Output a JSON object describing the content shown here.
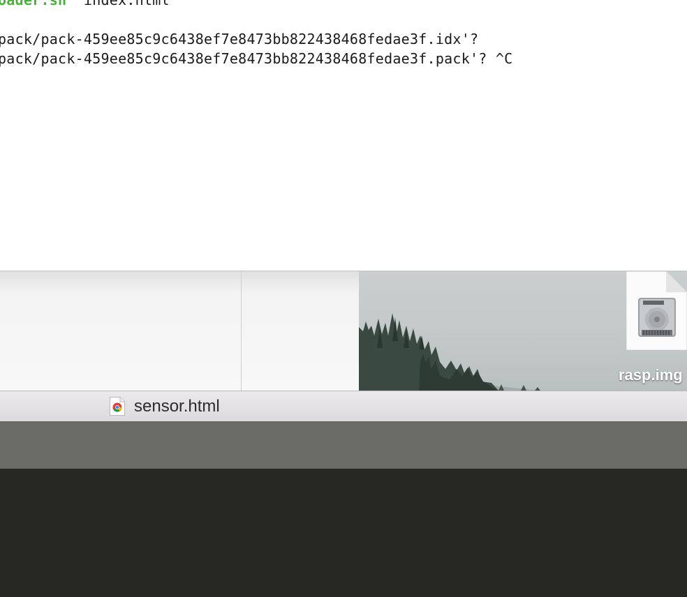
{
  "terminal": {
    "line0_green": "oader.sh",
    "line0_rest": "  index.html",
    "line1": "pack/pack-459ee85c9c6438ef7e8473bb822438468fedae3f.idx'?",
    "line2": "pack/pack-459ee85c9c6438ef7e8473bb822438468fedae3f.pack'? ^C"
  },
  "desktop": {
    "disk_label": "rasp.img"
  },
  "tab": {
    "file_name": "sensor.html"
  },
  "colors": {
    "terminal_bg": "#ffffff",
    "terminal_text": "#1a1a1a",
    "script_green": "#47b13a",
    "tab_bar": "#e2e0e2",
    "gray_band": "#6b6c66",
    "dark_area": "#272823"
  },
  "icons": [
    "disk-image-icon",
    "chrome-file-icon"
  ]
}
